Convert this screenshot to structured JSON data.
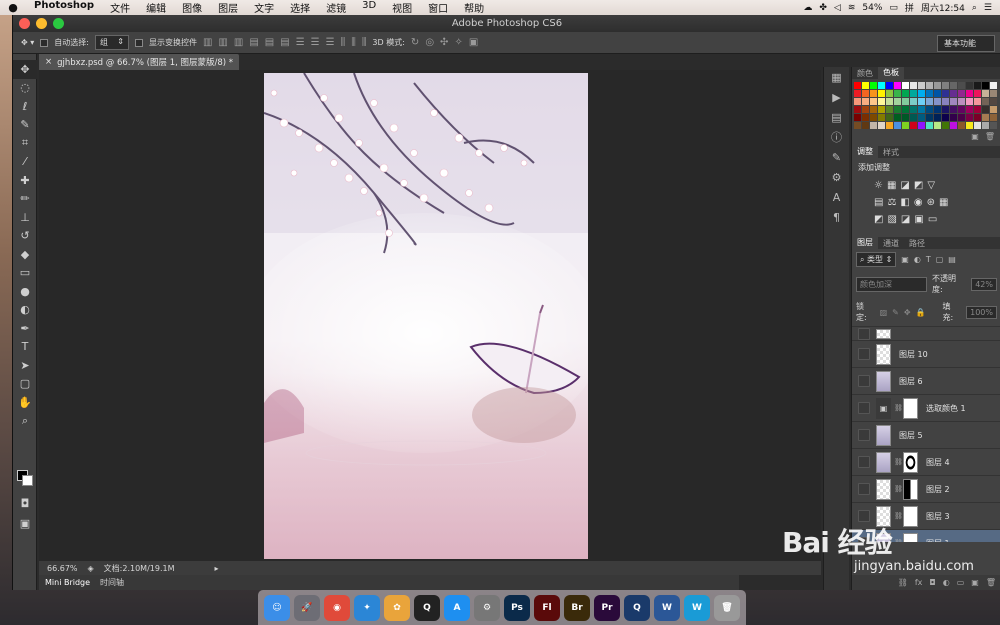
{
  "menubar": {
    "apple": "",
    "items": [
      "Photoshop",
      "文件",
      "编辑",
      "图像",
      "图层",
      "文字",
      "选择",
      "滤镜",
      "3D",
      "视图",
      "窗口",
      "帮助"
    ],
    "battery": "54%",
    "ime": "拼",
    "clock": "周六12:54"
  },
  "window": {
    "title": "Adobe Photoshop CS6"
  },
  "options": {
    "auto_select_label": "自动选择:",
    "auto_select_value": "组",
    "transform_label": "显示变换控件",
    "mode3d_label": "3D 模式:",
    "workspace": "基本功能"
  },
  "document": {
    "tab_close": "×",
    "tab_title": "gjhbxz.psd @ 66.7% (图层 1, 图层蒙版/8) *",
    "zoom": "66.67%",
    "doc_size": "文档:2.10M/19.1M"
  },
  "bottom_tabs": [
    "Mini Bridge",
    "时间轴"
  ],
  "panels": {
    "color_tabs": [
      "颜色",
      "色板"
    ],
    "adjust_tabs": [
      "调整",
      "样式"
    ],
    "add_adjustment": "添加调整",
    "layers_tabs": [
      "图层",
      "通道",
      "路径"
    ],
    "filter_kind": "类型",
    "blend_mode": "颜色加深",
    "opacity_label": "不透明度:",
    "opacity_value": "42%",
    "lock_label": "锁定:",
    "fill_label": "填充:",
    "fill_value": "100%"
  },
  "layers": [
    {
      "name": "",
      "thumb": "checker",
      "mask": null,
      "selected": false
    },
    {
      "name": "图层 10",
      "thumb": "checker",
      "mask": null,
      "selected": false
    },
    {
      "name": "图层 6",
      "thumb": "image",
      "mask": null,
      "selected": false
    },
    {
      "name": "选取颜色 1",
      "thumb": "adjust",
      "mask": "white",
      "selected": false
    },
    {
      "name": "图层 5",
      "thumb": "image",
      "mask": null,
      "selected": false
    },
    {
      "name": "图层 4",
      "thumb": "image",
      "mask": "ring",
      "selected": false
    },
    {
      "name": "图层 2",
      "thumb": "checker",
      "mask": "dark",
      "selected": false
    },
    {
      "name": "图层 3",
      "thumb": "checker",
      "mask": "white",
      "selected": false
    },
    {
      "name": "图层 1",
      "thumb": "image",
      "mask": "white",
      "selected": true
    }
  ],
  "dock": [
    {
      "name": "finder",
      "label": "☺",
      "color": "#3b8ee8"
    },
    {
      "name": "launchpad",
      "label": "🚀",
      "color": "#6d6d75"
    },
    {
      "name": "chrome",
      "label": "◉",
      "color": "#e04a3a"
    },
    {
      "name": "safari",
      "label": "✦",
      "color": "#2b86d6"
    },
    {
      "name": "photos",
      "label": "✿",
      "color": "#e9a43b"
    },
    {
      "name": "qq",
      "label": "Q",
      "color": "#222"
    },
    {
      "name": "appstore",
      "label": "A",
      "color": "#1e8ff0"
    },
    {
      "name": "preferences",
      "label": "⚙",
      "color": "#777"
    },
    {
      "name": "photoshop",
      "label": "Ps",
      "color": "#0b2a4a"
    },
    {
      "name": "flash",
      "label": "Fl",
      "color": "#5a0a0a"
    },
    {
      "name": "bridge",
      "label": "Br",
      "color": "#3a2a0a"
    },
    {
      "name": "premiere",
      "label": "Pr",
      "color": "#2a0a3a"
    },
    {
      "name": "quicktime",
      "label": "Q",
      "color": "#1a3a6a"
    },
    {
      "name": "word",
      "label": "W",
      "color": "#2b5797"
    },
    {
      "name": "wunderlist",
      "label": "W",
      "color": "#1a9bd6"
    },
    {
      "name": "trash",
      "label": "🗑",
      "color": "#999"
    }
  ],
  "watermark": {
    "brand": "Bai 经验",
    "domain": "jingyan.baidu.com"
  },
  "colors": {
    "swatches": [
      "#ff0000",
      "#ffff00",
      "#00ff00",
      "#00ffff",
      "#0000ff",
      "#ff00ff",
      "#ffffff",
      "#e6e6e6",
      "#cccccc",
      "#b3b3b3",
      "#999999",
      "#808080",
      "#666666",
      "#4d4d4d",
      "#333333",
      "#1a1a1a",
      "#000000",
      "#f2f2f2",
      "#ed1c24",
      "#f26522",
      "#f7941d",
      "#fff200",
      "#8dc63f",
      "#39b54a",
      "#00a651",
      "#00a99d",
      "#00aeef",
      "#0072bc",
      "#0054a6",
      "#2e3192",
      "#662d91",
      "#92278f",
      "#ec008c",
      "#ed145b",
      "#c7b299",
      "#998675",
      "#f7977a",
      "#f9ad81",
      "#fdc68a",
      "#fff79a",
      "#c4df9b",
      "#a3d39c",
      "#82ca9d",
      "#7bcdc8",
      "#6ecff6",
      "#7ea7d8",
      "#8493ca",
      "#8882be",
      "#a187be",
      "#bc8dbf",
      "#f49ac2",
      "#f6989d",
      "#736357",
      "#534741",
      "#9e0b0f",
      "#a0410d",
      "#a36209",
      "#aba000",
      "#598527",
      "#1a7b30",
      "#007236",
      "#00746b",
      "#0076a3",
      "#004b80",
      "#003471",
      "#1b1464",
      "#440e62",
      "#630460",
      "#9e005d",
      "#9e0039",
      "#362f2d",
      "#c69c6d",
      "#790000",
      "#7b2e00",
      "#7d4900",
      "#827b00",
      "#406618",
      "#005e20",
      "#005826",
      "#005952",
      "#005b7f",
      "#003663",
      "#002157",
      "#0d004c",
      "#32004b",
      "#4b0049",
      "#7b0046",
      "#7a0026",
      "#a67c52",
      "#8c6239",
      "#754c24",
      "#603913",
      "#c2b5a8",
      "#e0d4c7",
      "#f5a623",
      "#4a90e2",
      "#7ed321",
      "#d0021b",
      "#9013fe",
      "#50e3c2",
      "#b8e986",
      "#417505",
      "#bd10e0",
      "#8b572a",
      "#f8e71c",
      "#e2e2e2",
      "#aaaaaa",
      "#555555"
    ]
  }
}
